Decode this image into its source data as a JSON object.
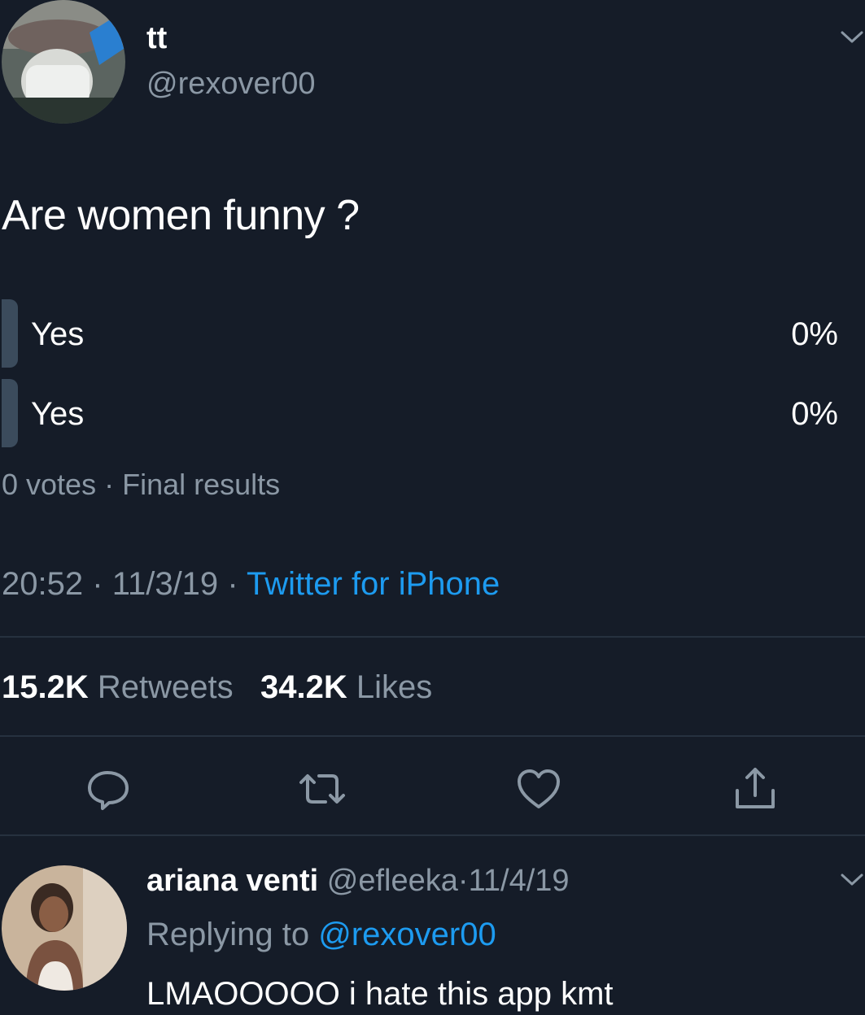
{
  "tweet": {
    "display_name": "tt",
    "handle": "@rexover00",
    "text": "Are women funny ?",
    "poll": {
      "options": [
        {
          "label": "Yes",
          "percent": "0%"
        },
        {
          "label": "Yes",
          "percent": "0%"
        }
      ],
      "votes": "0 votes",
      "separator": "·",
      "status": "Final results"
    },
    "time": "20:52",
    "date": "11/3/19",
    "source": "Twitter for iPhone",
    "retweets_count": "15.2K",
    "retweets_label": "Retweets",
    "likes_count": "34.2K",
    "likes_label": "Likes"
  },
  "actions": {
    "reply_icon": "reply-icon",
    "retweet_icon": "retweet-icon",
    "like_icon": "heart-icon",
    "share_icon": "share-icon"
  },
  "reply": {
    "display_name": "ariana venti",
    "handle": "@efleeka",
    "date": "11/4/19",
    "replying_prefix": "Replying to",
    "replying_to": "@rexover00",
    "text": "LMAOOOOO i hate this app kmt"
  },
  "colors": {
    "background": "#151c28",
    "link": "#1d9bf0",
    "secondary_text": "#8b98a5",
    "poll_bar": "#3b4b5c"
  }
}
